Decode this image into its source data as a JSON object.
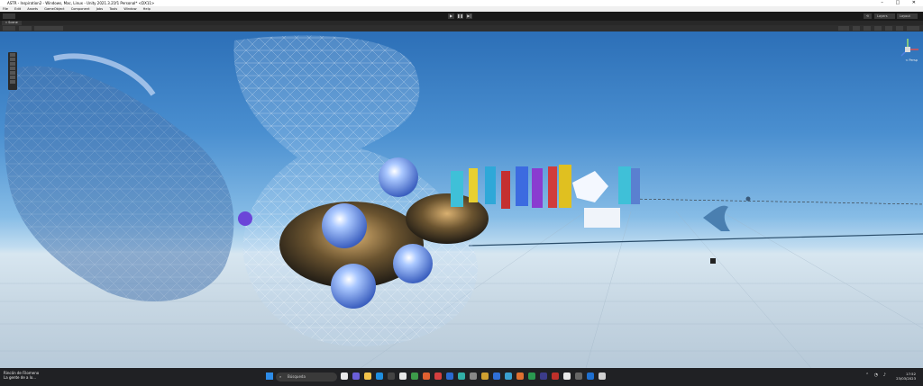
{
  "window": {
    "title": "ASTR - Inspiration2 - Windows, Mac, Linux - Unity 2021.3.21f1 Personal* <DX11>"
  },
  "menu": [
    "File",
    "Edit",
    "Assets",
    "GameObject",
    "Component",
    "Jobs",
    "Tools",
    "Window",
    "Help"
  ],
  "toolbar": {
    "layers": "Layers",
    "layout": "Layout"
  },
  "tabs": {
    "scene": "Scene"
  },
  "gizmo": {
    "label": "< Persp"
  },
  "taskbar": {
    "weather_title": "Rincón de Filomeno",
    "weather_sub": "La gente de a lo...",
    "search_placeholder": "Búsqueda",
    "time": "17:52",
    "date": "23/03/2023"
  },
  "colors": {
    "sky_top": "#2c6fb7",
    "horizon": "#d7e6f0",
    "ground": "#b7c9d8",
    "taskbar": "#202124"
  }
}
